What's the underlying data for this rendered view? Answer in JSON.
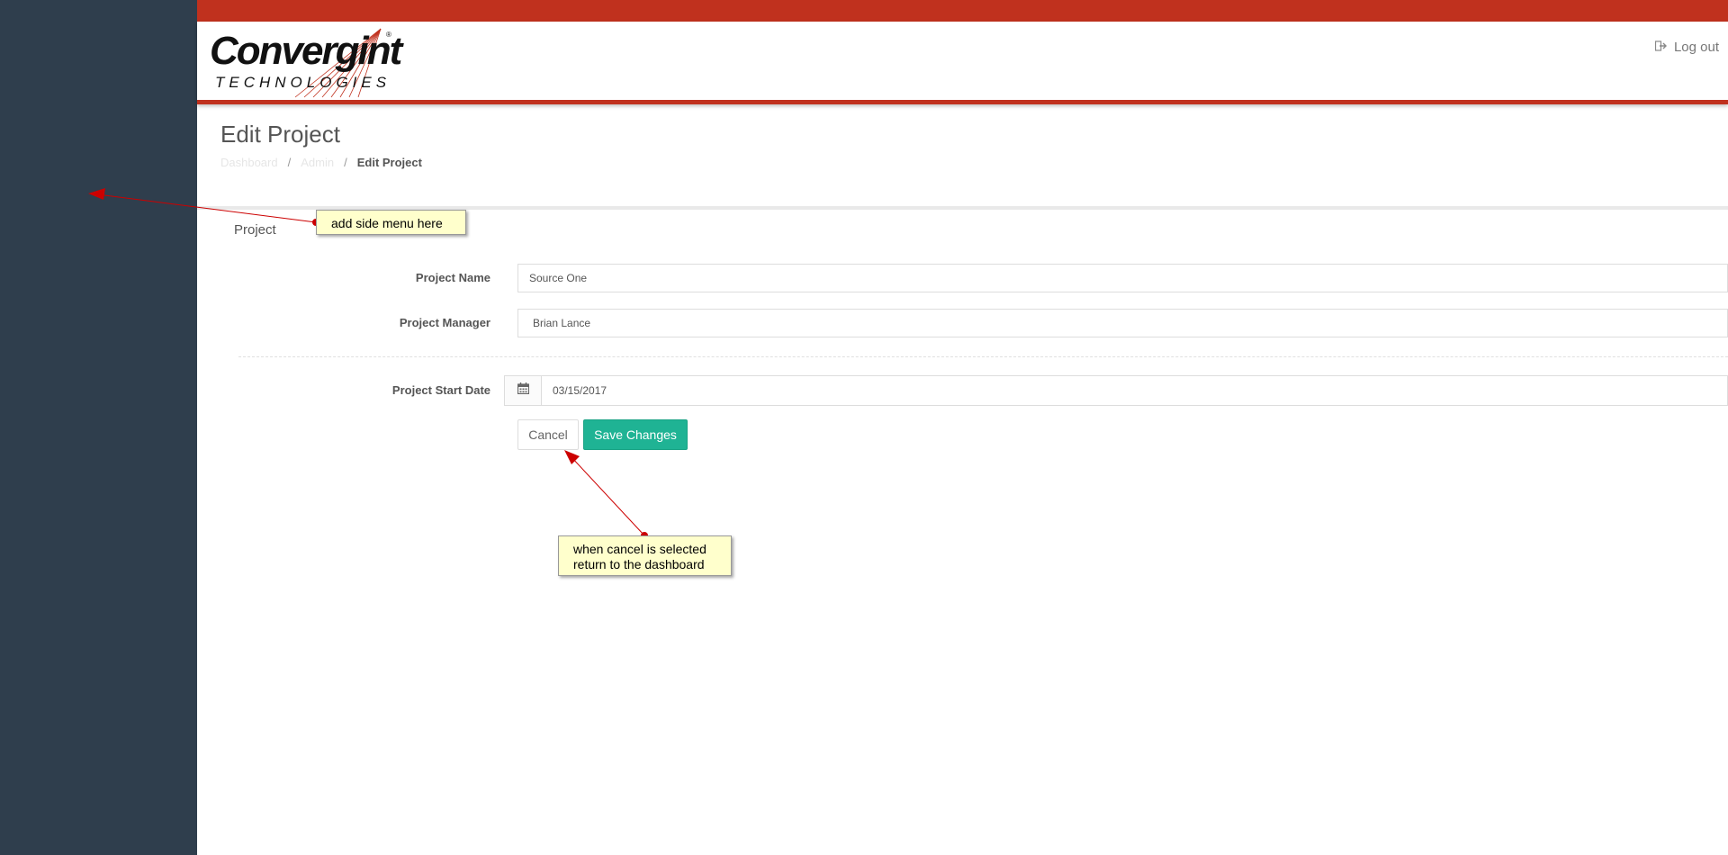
{
  "header": {
    "logo": {
      "name": "Convergint",
      "sub": "TECHNOLOGIES",
      "reg": "®"
    },
    "logout_label": "Log out",
    "logout_icon": "sign-out-icon"
  },
  "page": {
    "title": "Edit Project",
    "breadcrumb": [
      "Dashboard",
      "Admin",
      "Edit Project"
    ],
    "breadcrumb_sep": "/"
  },
  "form": {
    "section": "Project",
    "project_name_label": "Project Name",
    "project_name_value": "Source One",
    "project_manager_label": "Project Manager",
    "project_manager_value": "Brian Lance",
    "start_date_label": "Project Start Date",
    "start_date_value": "03/15/2017",
    "calendar_icon": "calendar-icon",
    "cancel_label": "Cancel",
    "save_label": "Save Changes"
  },
  "annotations": {
    "side_menu_note": "add side menu here",
    "cancel_note_line1": "when cancel is selected",
    "cancel_note_line2": "return to the dashboard"
  },
  "colors": {
    "sidebar": "#2f3e4d",
    "brand_red": "#c0311e",
    "primary_green": "#1fb394",
    "note_bg": "#ffffcc",
    "arrow_red": "#cc0000"
  }
}
